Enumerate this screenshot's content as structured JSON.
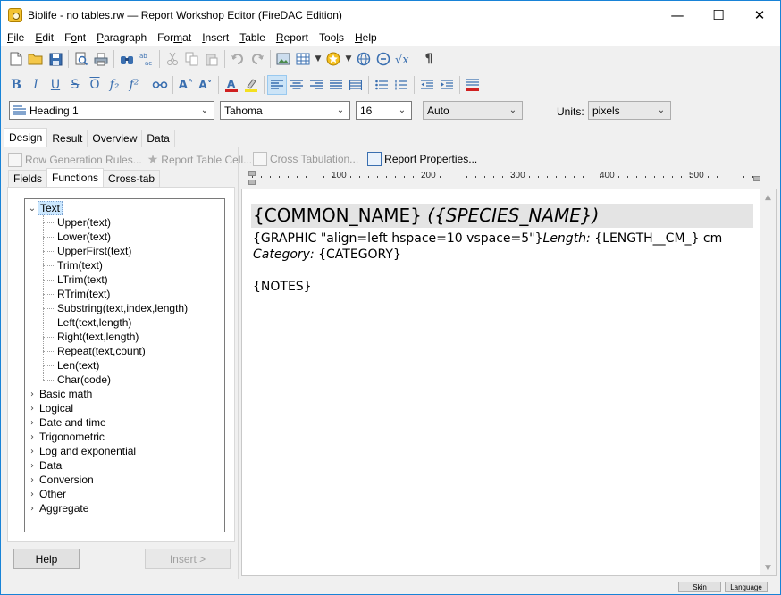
{
  "window": {
    "title": "Biolife - no tables.rw — Report Workshop Editor (FireDAC Edition)",
    "controls": {
      "minimize": "—",
      "maximize": "☐",
      "close": "✕"
    }
  },
  "menu": [
    {
      "label": "File",
      "key": "F"
    },
    {
      "label": "Edit",
      "key": "E"
    },
    {
      "label": "Font",
      "key": "o"
    },
    {
      "label": "Paragraph",
      "key": "P"
    },
    {
      "label": "Format",
      "key": "m"
    },
    {
      "label": "Insert",
      "key": "I"
    },
    {
      "label": "Table",
      "key": "T"
    },
    {
      "label": "Report",
      "key": "R"
    },
    {
      "label": "Tools",
      "key": "l"
    },
    {
      "label": "Help",
      "key": "H"
    }
  ],
  "format_toolbar": {
    "bold": "B",
    "italic": "I",
    "underline": "U",
    "strike": "S",
    "overline": "O",
    "subscript": "f₂",
    "superscript": "f²",
    "grow": "A˄",
    "shrink": "A˅",
    "pilcrow": "¶"
  },
  "combos": {
    "style": "Heading 1",
    "font": "Tahoma",
    "size": "16",
    "color": "Auto",
    "units_label": "Units:",
    "units": "pixels"
  },
  "main_tabs": [
    "Design",
    "Result",
    "Overview",
    "Data"
  ],
  "left_toolbar": [
    "Row Generation Rules...",
    "Report Table Cell..."
  ],
  "sub_tabs": [
    "Fields",
    "Functions",
    "Cross-tab"
  ],
  "tree": {
    "root": "Text",
    "children": [
      "Upper(text)",
      "Lower(text)",
      "UpperFirst(text)",
      "Trim(text)",
      "LTrim(text)",
      "RTrim(text)",
      "Substring(text,index,length)",
      "Left(text,length)",
      "Right(text,length)",
      "Repeat(text,count)",
      "Len(text)",
      "Char(code)"
    ],
    "groups": [
      "Basic math",
      "Logical",
      "Date and time",
      "Trigonometric",
      "Log and exponential",
      "Data",
      "Conversion",
      "Other",
      "Aggregate"
    ]
  },
  "buttons": {
    "help": "Help",
    "insert": "Insert >"
  },
  "right_toolbar": [
    "Cross Tabulation...",
    "Report Properties..."
  ],
  "ruler": {
    "labels": [
      "100",
      "200",
      "300",
      "400",
      "500"
    ]
  },
  "document": {
    "heading_plain": "{COMMON_NAME}",
    "heading_italic": "({SPECIES_NAME})",
    "line1_plain": "{GRAPHIC \"align=left hspace=10 vspace=5\"}",
    "line1_italic": "Length:",
    "line1_tail": " {LENGTH__CM_} cm",
    "line2_italic": "Category:",
    "line2_tail": " {CATEGORY}",
    "notes": "{NOTES}"
  },
  "status": {
    "skin": "Skin",
    "language": "Language"
  }
}
